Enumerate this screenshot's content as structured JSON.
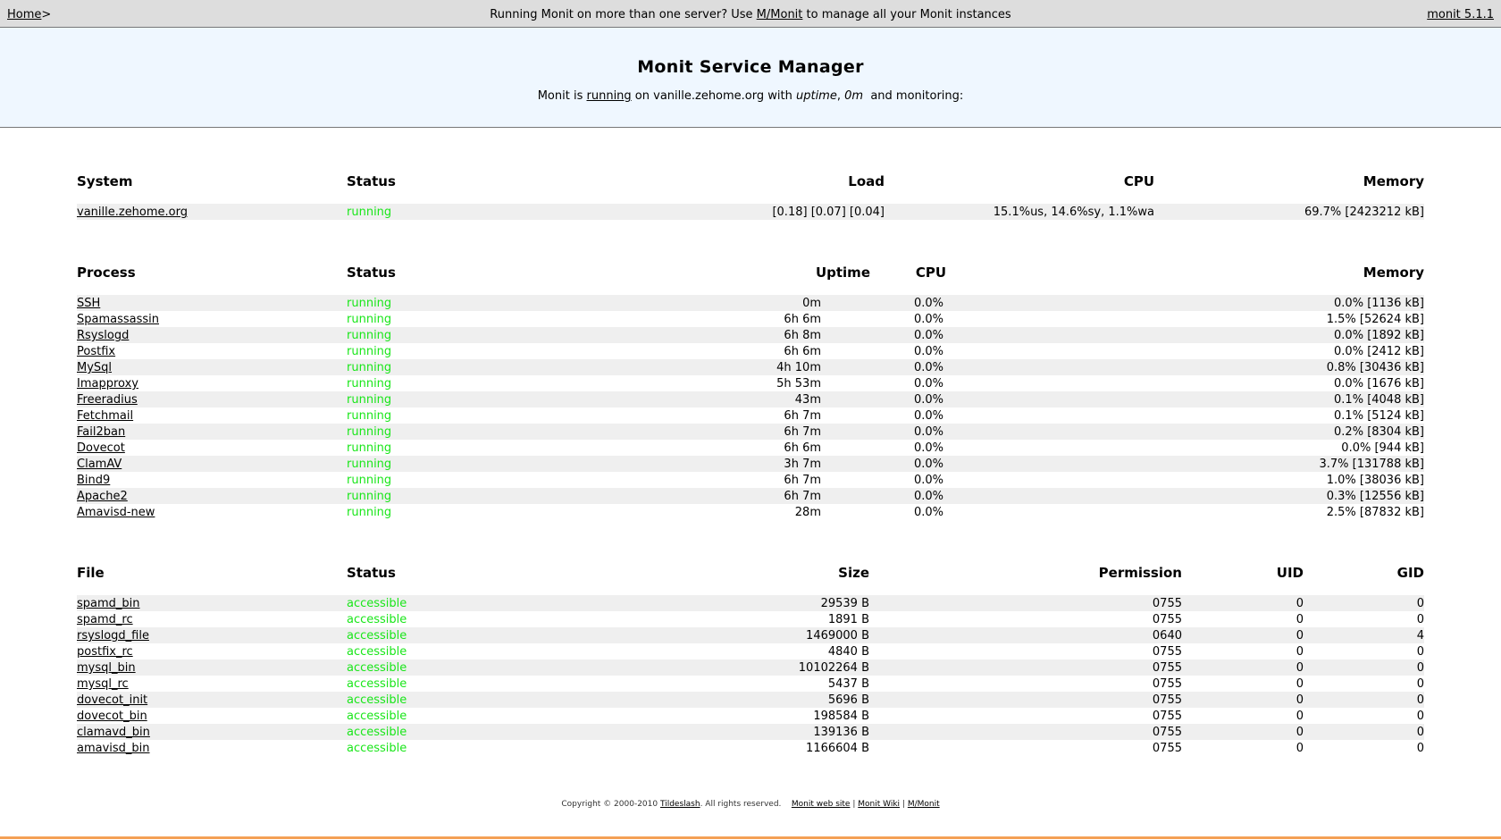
{
  "topbar": {
    "home": "Home",
    "home_sep": ">",
    "msg_pre": "Running Monit on more than one server? Use ",
    "msg_link": "M/Monit",
    "msg_post": " to manage all your Monit instances",
    "version": "monit 5.1.1"
  },
  "header": {
    "title": "Monit Service Manager",
    "sub_pre": "Monit is ",
    "sub_link": "running",
    "sub_mid": " on vanille.zehome.org with ",
    "sub_uptime_label": "uptime",
    "sub_comma": ", ",
    "sub_uptime_value": "0m",
    "sub_post": " and monitoring:"
  },
  "system": {
    "headers": {
      "name": "System",
      "status": "Status",
      "load": "Load",
      "cpu": "CPU",
      "memory": "Memory"
    },
    "rows": [
      {
        "name": "vanille.zehome.org",
        "status": "running",
        "load": "[0.18] [0.07] [0.04]",
        "cpu": "15.1%us, 14.6%sy, 1.1%wa",
        "memory": "69.7% [2423212 kB]"
      }
    ]
  },
  "process": {
    "headers": {
      "name": "Process",
      "status": "Status",
      "uptime": "Uptime",
      "cpu": "CPU",
      "memory": "Memory"
    },
    "rows": [
      {
        "name": "SSH",
        "status": "running",
        "uptime": "0m",
        "cpu": "0.0%",
        "memory": "0.0% [1136 kB]"
      },
      {
        "name": "Spamassassin",
        "status": "running",
        "uptime": "6h 6m",
        "cpu": "0.0%",
        "memory": "1.5% [52624 kB]"
      },
      {
        "name": "Rsyslogd",
        "status": "running",
        "uptime": "6h 8m",
        "cpu": "0.0%",
        "memory": "0.0% [1892 kB]"
      },
      {
        "name": "Postfix",
        "status": "running",
        "uptime": "6h 6m",
        "cpu": "0.0%",
        "memory": "0.0% [2412 kB]"
      },
      {
        "name": "MySql",
        "status": "running",
        "uptime": "4h 10m",
        "cpu": "0.0%",
        "memory": "0.8% [30436 kB]"
      },
      {
        "name": "Imapproxy",
        "status": "running",
        "uptime": "5h 53m",
        "cpu": "0.0%",
        "memory": "0.0% [1676 kB]"
      },
      {
        "name": "Freeradius",
        "status": "running",
        "uptime": "43m",
        "cpu": "0.0%",
        "memory": "0.1% [4048 kB]"
      },
      {
        "name": "Fetchmail",
        "status": "running",
        "uptime": "6h 7m",
        "cpu": "0.0%",
        "memory": "0.1% [5124 kB]"
      },
      {
        "name": "Fail2ban",
        "status": "running",
        "uptime": "6h 7m",
        "cpu": "0.0%",
        "memory": "0.2% [8304 kB]"
      },
      {
        "name": "Dovecot",
        "status": "running",
        "uptime": "6h 6m",
        "cpu": "0.0%",
        "memory": "0.0% [944 kB]"
      },
      {
        "name": "ClamAV",
        "status": "running",
        "uptime": "3h 7m",
        "cpu": "0.0%",
        "memory": "3.7% [131788 kB]"
      },
      {
        "name": "Bind9",
        "status": "running",
        "uptime": "6h 7m",
        "cpu": "0.0%",
        "memory": "1.0% [38036 kB]"
      },
      {
        "name": "Apache2",
        "status": "running",
        "uptime": "6h 7m",
        "cpu": "0.0%",
        "memory": "0.3% [12556 kB]"
      },
      {
        "name": "Amavisd-new",
        "status": "running",
        "uptime": "28m",
        "cpu": "0.0%",
        "memory": "2.5% [87832 kB]"
      }
    ]
  },
  "file": {
    "headers": {
      "name": "File",
      "status": "Status",
      "size": "Size",
      "permission": "Permission",
      "uid": "UID",
      "gid": "GID"
    },
    "rows": [
      {
        "name": "spamd_bin",
        "status": "accessible",
        "size": "29539 B",
        "permission": "0755",
        "uid": "0",
        "gid": "0"
      },
      {
        "name": "spamd_rc",
        "status": "accessible",
        "size": "1891 B",
        "permission": "0755",
        "uid": "0",
        "gid": "0"
      },
      {
        "name": "rsyslogd_file",
        "status": "accessible",
        "size": "1469000 B",
        "permission": "0640",
        "uid": "0",
        "gid": "4"
      },
      {
        "name": "postfix_rc",
        "status": "accessible",
        "size": "4840 B",
        "permission": "0755",
        "uid": "0",
        "gid": "0"
      },
      {
        "name": "mysql_bin",
        "status": "accessible",
        "size": "10102264 B",
        "permission": "0755",
        "uid": "0",
        "gid": "0"
      },
      {
        "name": "mysql_rc",
        "status": "accessible",
        "size": "5437 B",
        "permission": "0755",
        "uid": "0",
        "gid": "0"
      },
      {
        "name": "dovecot_init",
        "status": "accessible",
        "size": "5696 B",
        "permission": "0755",
        "uid": "0",
        "gid": "0"
      },
      {
        "name": "dovecot_bin",
        "status": "accessible",
        "size": "198584 B",
        "permission": "0755",
        "uid": "0",
        "gid": "0"
      },
      {
        "name": "clamavd_bin",
        "status": "accessible",
        "size": "139136 B",
        "permission": "0755",
        "uid": "0",
        "gid": "0"
      },
      {
        "name": "amavisd_bin",
        "status": "accessible",
        "size": "1166604 B",
        "permission": "0755",
        "uid": "0",
        "gid": "0"
      }
    ]
  },
  "footer": {
    "copyright": "Copyright © 2000-2010 ",
    "company": "Tildeslash",
    "rights": ". All rights reserved.",
    "link_website": "Monit web site",
    "sep": "|",
    "link_wiki": "Monit Wiki",
    "link_mmonit": "M/Monit"
  },
  "colors": {
    "status_ok": "#19e619",
    "header_bg": "#eff7ff",
    "topbar_bg": "#dddddd",
    "row_alt": "#efefef",
    "bottom_line": "#f4a055"
  }
}
